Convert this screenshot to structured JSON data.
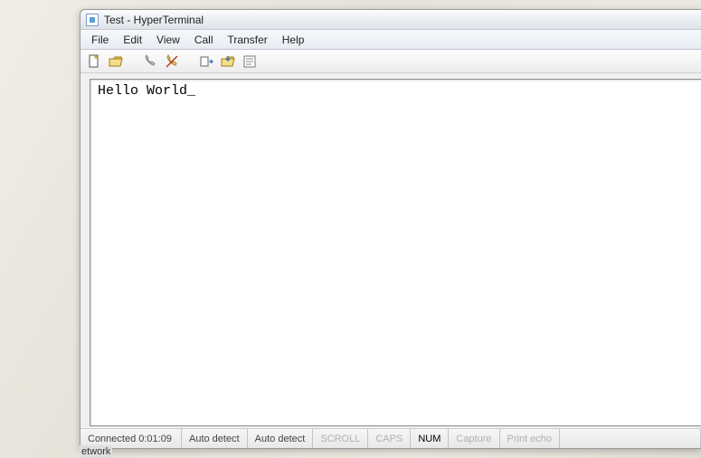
{
  "title": "Test - HyperTerminal",
  "menu": {
    "file": "File",
    "edit": "Edit",
    "view": "View",
    "call": "Call",
    "transfer": "Transfer",
    "help": "Help"
  },
  "toolbar": {
    "new": "new-file-icon",
    "open": "open-folder-icon",
    "call": "call-phone-icon",
    "disconnect": "disconnect-phone-icon",
    "send": "send-file-icon",
    "receive": "receive-file-icon",
    "properties": "properties-icon"
  },
  "terminal": {
    "content": "Hello World_"
  },
  "status": {
    "connection": "Connected 0:01:09",
    "detect1": "Auto detect",
    "detect2": "Auto detect",
    "scroll": "SCROLL",
    "caps": "CAPS",
    "num": "NUM",
    "capture": "Capture",
    "printecho": "Print echo"
  },
  "taskbar_fragment": "etwork"
}
